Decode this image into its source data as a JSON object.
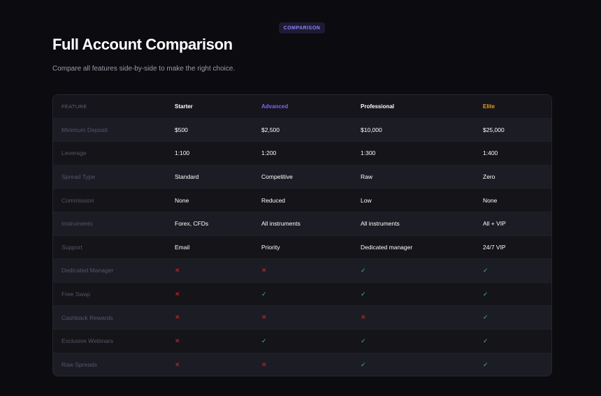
{
  "badge": "COMPARISON",
  "title": "Full Account Comparison",
  "subtitle": "Compare all features side-by-side to make the right choice.",
  "colors": {
    "advanced": "#7b68ee",
    "elite": "#e8a020",
    "check": "#35c38a",
    "cross": "#e0252a"
  },
  "table": {
    "headers": [
      "FEATURE",
      "Starter",
      "Advanced",
      "Professional",
      "Elite"
    ],
    "rows": [
      {
        "feature": "Minimum Deposit",
        "values": [
          "$500",
          "$2,500",
          "$10,000",
          "$25,000"
        ]
      },
      {
        "feature": "Leverage",
        "values": [
          "1:100",
          "1:200",
          "1:300",
          "1:400"
        ]
      },
      {
        "feature": "Spread Type",
        "values": [
          "Standard",
          "Competitive",
          "Raw",
          "Zero"
        ]
      },
      {
        "feature": "Commission",
        "values": [
          "None",
          "Reduced",
          "Low",
          "None"
        ]
      },
      {
        "feature": "Instruments",
        "values": [
          "Forex, CFDs",
          "All instruments",
          "All instruments",
          "All + VIP"
        ]
      },
      {
        "feature": "Support",
        "values": [
          "Email",
          "Priority",
          "Dedicated manager",
          "24/7 VIP"
        ]
      },
      {
        "feature": "Dedicated Manager",
        "values": [
          false,
          false,
          true,
          true
        ]
      },
      {
        "feature": "Free Swap",
        "values": [
          false,
          true,
          true,
          true
        ]
      },
      {
        "feature": "Cashback Rewards",
        "values": [
          false,
          false,
          false,
          true
        ]
      },
      {
        "feature": "Exclusive Webinars",
        "values": [
          false,
          true,
          true,
          true
        ]
      },
      {
        "feature": "Raw Spreads",
        "values": [
          false,
          false,
          true,
          true
        ]
      }
    ],
    "check_icon": "check-icon",
    "cross_icon": "cross-icon"
  }
}
